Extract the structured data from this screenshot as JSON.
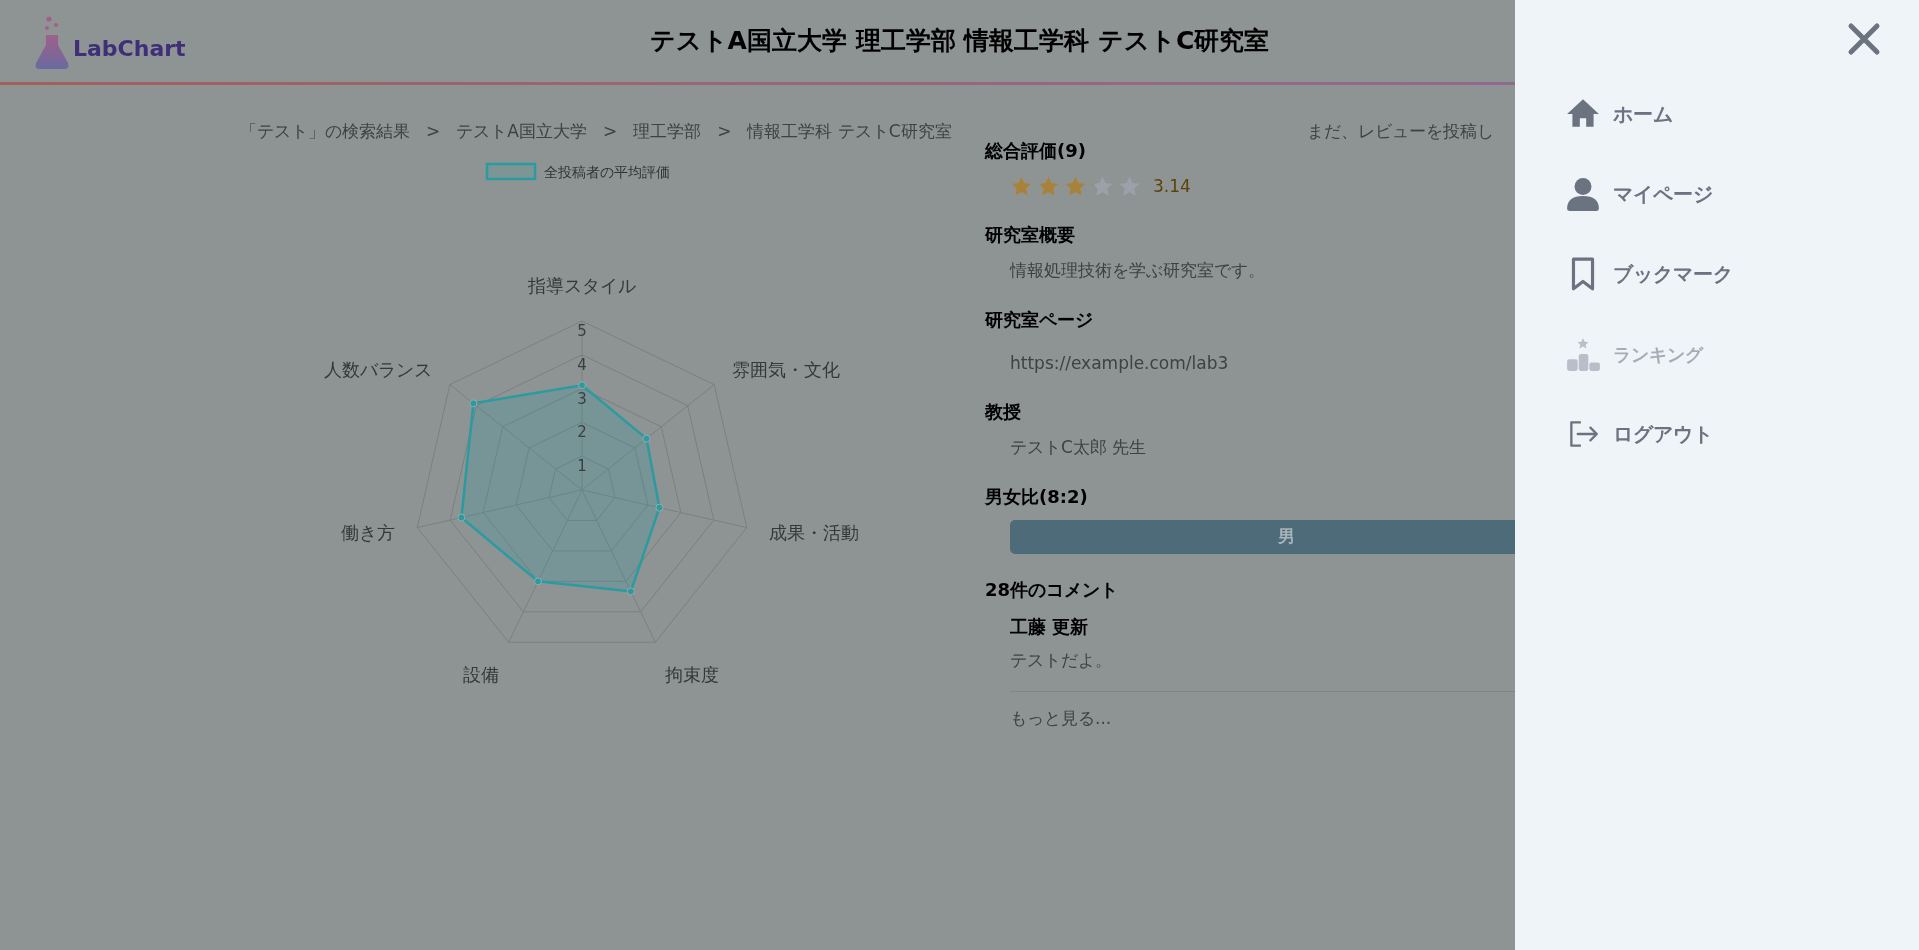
{
  "header": {
    "logo": "LabChart",
    "title": "テストA国立大学 理工学部 情報工学科 テストC研究室"
  },
  "breadcrumb": [
    "「テスト」の検索結果",
    ">",
    "テストA国立大学",
    ">",
    "理工学部",
    ">",
    "情報工学科 テストC研究室"
  ],
  "review_prompt": "まだ、レビューを投稿し",
  "chart": {
    "chart_data": {
      "type": "radar",
      "categories": [
        "指導スタイル",
        "雰囲気・文化",
        "成果・活動",
        "拘束度",
        "設備",
        "働き方",
        "人数バランス"
      ],
      "ylim": [
        0,
        5
      ],
      "yticks": [
        1,
        2,
        3,
        4,
        5
      ],
      "series": [
        {
          "name": "全投稿者の平均評価",
          "color": "#2a9ba0",
          "values": [
            3.1,
            2.44,
            2.35,
            3.33,
            3.0,
            3.66,
            4.11
          ]
        }
      ]
    }
  },
  "sections": [
    {
      "kind": "rating",
      "heading": "総合評価(9)",
      "stars": 3.14,
      "value": "3.14"
    },
    {
      "kind": "text",
      "heading": "研究室概要",
      "text": "情報処理技術を学ぶ研究室です。"
    },
    {
      "kind": "text",
      "heading": "研究室ページ",
      "text": "https://example.com/lab3"
    },
    {
      "kind": "text",
      "heading": "教授",
      "text": "テストC太郎 先生"
    },
    {
      "kind": "ratio",
      "heading": "男女比(8:2)",
      "level": 0.8,
      "label": "男"
    },
    {
      "kind": "comments",
      "heading": "28件のコメント",
      "comments": [
        {
          "author": "工藤 更新",
          "text": "テストだよ。"
        }
      ],
      "more": "もっと見る..."
    }
  ],
  "menu": {
    "items": [
      {
        "kind": "home",
        "label": "ホーム",
        "disabled": false
      },
      {
        "kind": "user",
        "label": "マイページ",
        "disabled": false
      },
      {
        "kind": "bookmark",
        "label": "ブックマーク",
        "disabled": false
      },
      {
        "kind": "ranking",
        "label": "ランキング",
        "disabled": true
      },
      {
        "kind": "logout",
        "label": "ログアウト",
        "disabled": false
      }
    ]
  }
}
